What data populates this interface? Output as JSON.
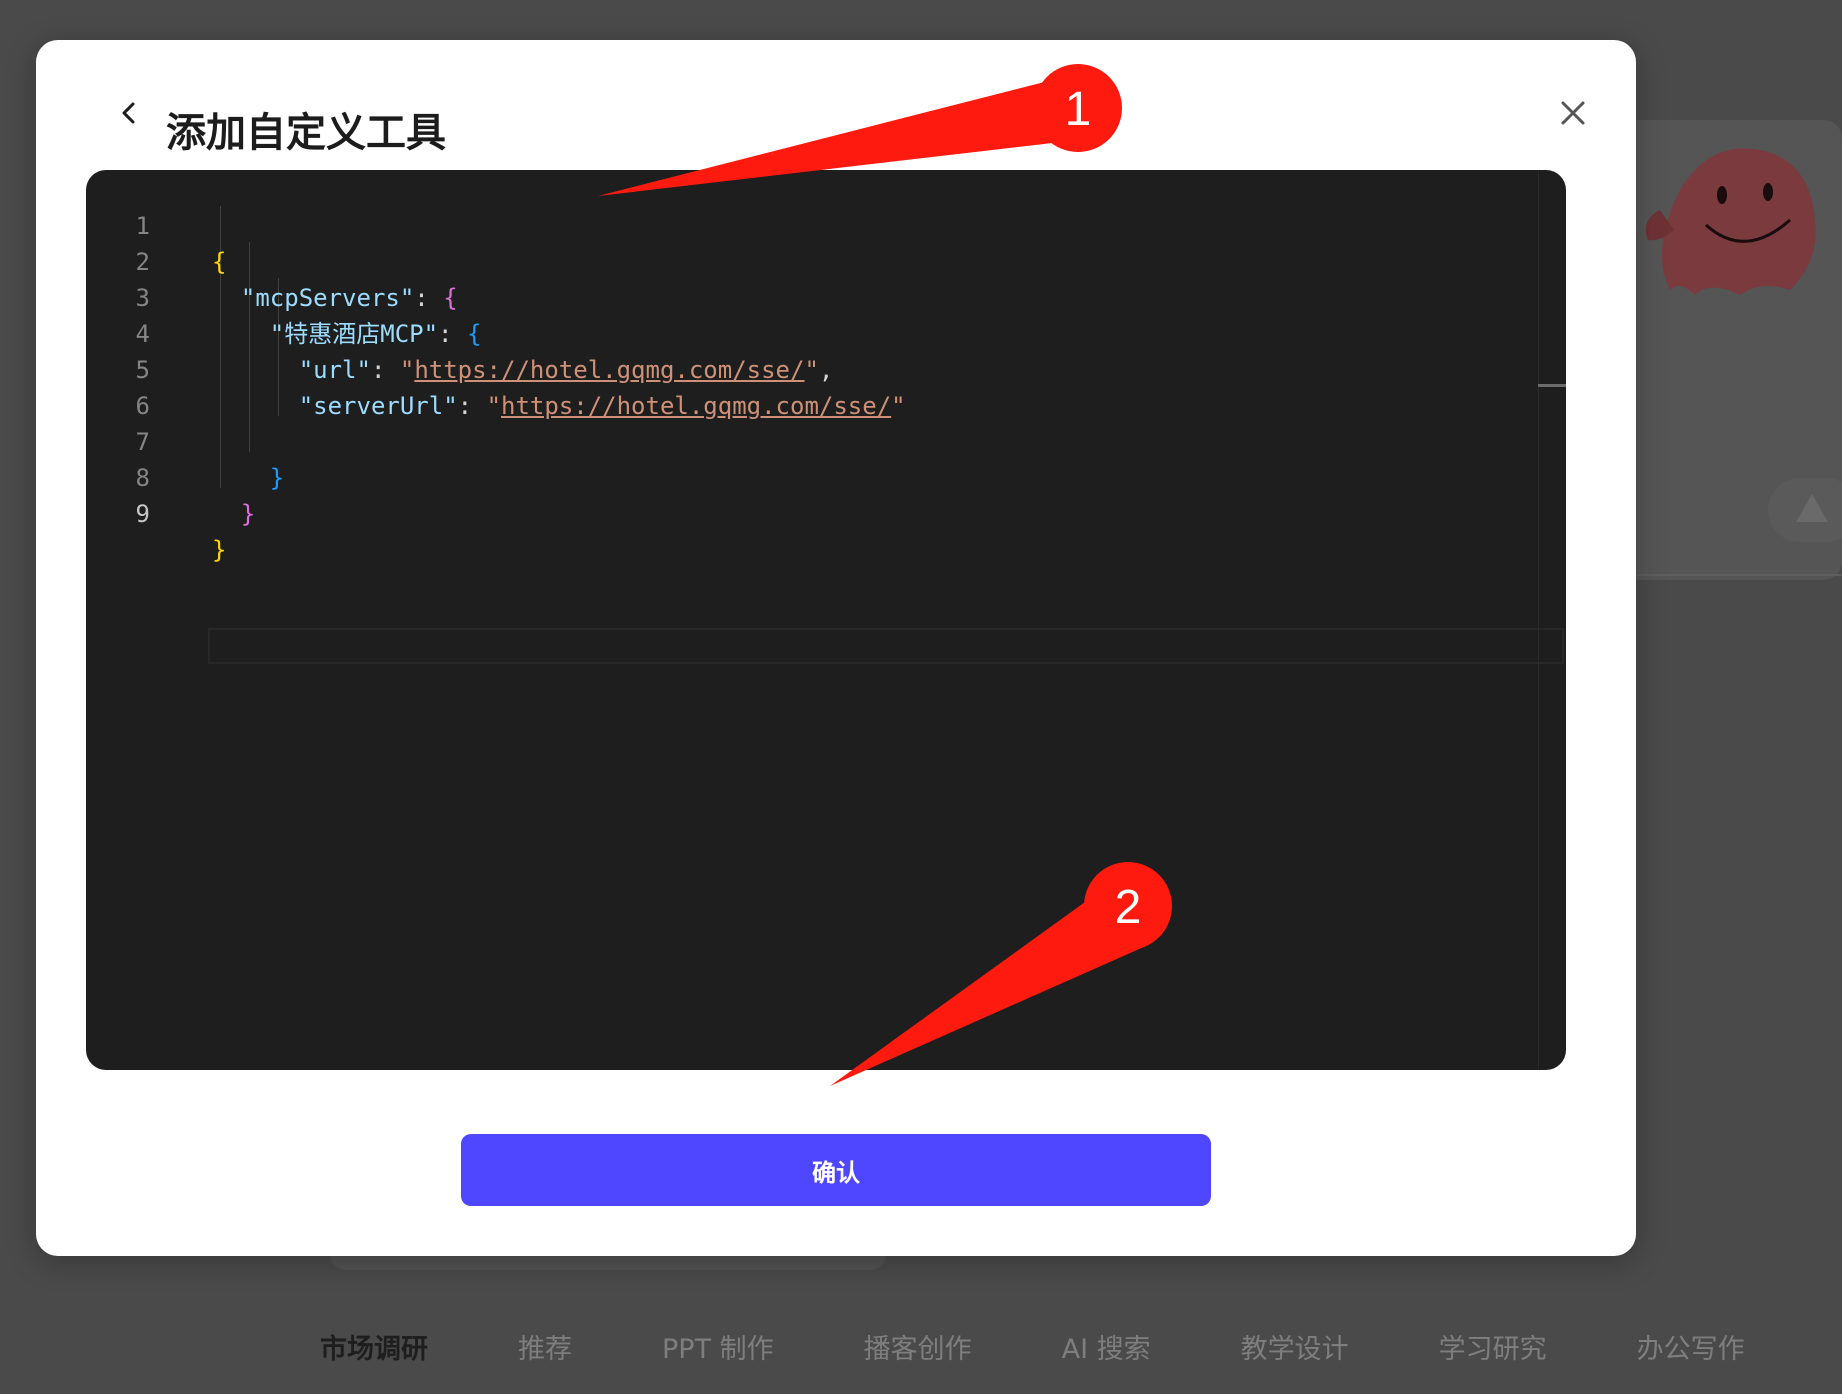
{
  "dialog": {
    "title": "添加自定义工具",
    "back_icon": "chevron-left-icon",
    "close_icon": "close-icon"
  },
  "editor": {
    "lines": [
      {
        "no": "1"
      },
      {
        "no": "2",
        "key": "\"mcpServers\""
      },
      {
        "no": "3",
        "key": "\"特惠酒店MCP\""
      },
      {
        "no": "4",
        "key": "\"url\"",
        "value": "https://hotel.gqmg.com/sse/"
      },
      {
        "no": "5",
        "key": "\"serverUrl\"",
        "value": "https://hotel.gqmg.com/sse/"
      },
      {
        "no": "6"
      },
      {
        "no": "7"
      },
      {
        "no": "8"
      },
      {
        "no": "9"
      }
    ],
    "colors": {
      "background": "#1e1e1e",
      "key": "#9cdcfe",
      "string": "#ce9178",
      "brace_level1": "#ffd700",
      "brace_level2": "#da70d6",
      "brace_level3": "#179fff"
    }
  },
  "confirm_button": {
    "label": "确认",
    "color": "#4f46ff"
  },
  "annotations": [
    {
      "label": "1"
    },
    {
      "label": "2"
    }
  ],
  "background": {
    "categories": [
      {
        "label": "市场调研",
        "active": true
      },
      {
        "label": "推荐"
      },
      {
        "label": "PPT 制作"
      },
      {
        "label": "播客创作"
      },
      {
        "label": "AI 搜索"
      },
      {
        "label": "教学设计"
      },
      {
        "label": "学习研究"
      },
      {
        "label": "办公写作"
      }
    ]
  }
}
